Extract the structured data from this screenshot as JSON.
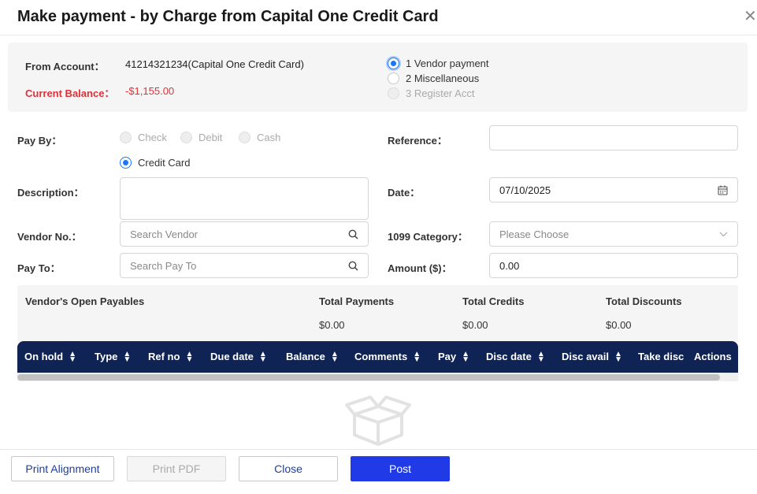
{
  "modal": {
    "title": "Make payment - by Charge from Capital One Credit Card",
    "close_glyph": "✕"
  },
  "account": {
    "from_account_label": "From Account：",
    "from_account_value": "41214321234(Capital One Credit Card)",
    "current_balance_label": "Current Balance：",
    "current_balance_value": "-$1,155.00",
    "payment_types": [
      {
        "label": "1 Vendor payment",
        "state": "checked"
      },
      {
        "label": "2 Miscellaneous",
        "state": "unchecked"
      },
      {
        "label": "3 Register Acct",
        "state": "disabled"
      }
    ]
  },
  "form": {
    "pay_by_label": "Pay By：",
    "pay_by_options": [
      {
        "label": "Check",
        "state": "disabled"
      },
      {
        "label": "Debit",
        "state": "disabled"
      },
      {
        "label": "Cash",
        "state": "disabled"
      },
      {
        "label": "Credit Card",
        "state": "checked"
      }
    ],
    "reference_label": "Reference：",
    "reference_value": "",
    "description_label": "Description：",
    "description_value": "",
    "date_label": "Date：",
    "date_value": "07/10/2025",
    "vendor_no_label": "Vendor No.：",
    "vendor_no_placeholder": "Search Vendor",
    "category_1099_label": "1099 Category：",
    "category_1099_placeholder": "Please Choose",
    "pay_to_label": "Pay To：",
    "pay_to_placeholder": "Search Pay To",
    "amount_label": "Amount ($)：",
    "amount_value": "0.00"
  },
  "payables": {
    "title": "Vendor's Open Payables",
    "total_payments_label": "Total Payments",
    "total_payments_value": "$0.00",
    "total_credits_label": "Total Credits",
    "total_credits_value": "$0.00",
    "total_discounts_label": "Total Discounts",
    "total_discounts_value": "$0.00"
  },
  "table": {
    "columns": [
      "On hold",
      "Type",
      "Ref no",
      "Due date",
      "Balance",
      "Comments",
      "Pay",
      "Disc date",
      "Disc avail",
      "Take disc",
      "Actions"
    ]
  },
  "footer": {
    "print_alignment": "Print Alignment",
    "print_pdf": "Print PDF",
    "close": "Close",
    "post": "Post"
  },
  "colors": {
    "primary": "#1f3ae6",
    "header_navy": "#0f2454",
    "balance_red": "#e0303a",
    "radio_blue": "#1677ff"
  }
}
